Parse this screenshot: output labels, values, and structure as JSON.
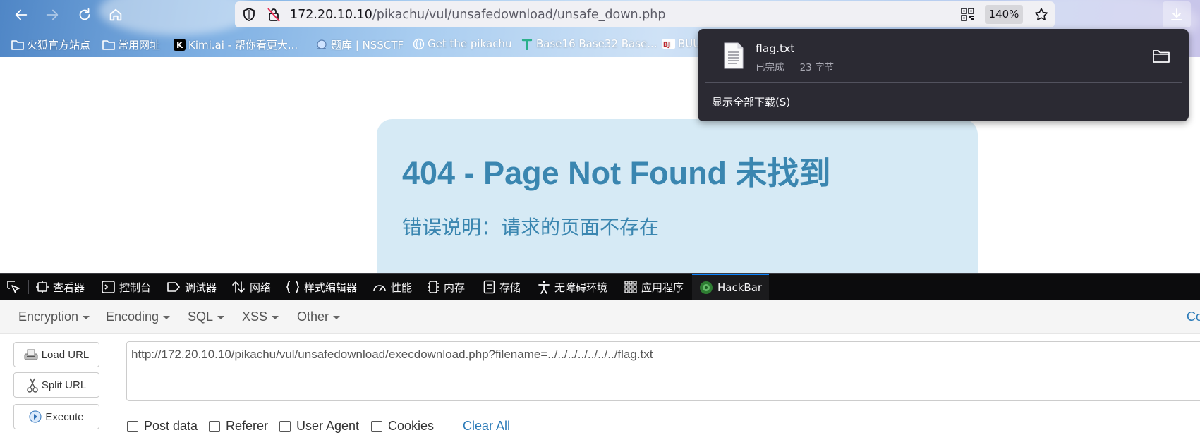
{
  "browser": {
    "url_host": "172.20.10.10",
    "url_path": "/pikachu/vul/unsafedownload/unsafe_down.php",
    "zoom": "140%"
  },
  "bookmarks": [
    {
      "label": "火狐官方站点",
      "icon": "folder-icon"
    },
    {
      "label": "常用网址",
      "icon": "folder-icon"
    },
    {
      "label": "Kimi.ai - 帮你看更大...",
      "icon": "kimi-icon"
    },
    {
      "label": "题库 | NSSCTF",
      "icon": "nssctf-icon"
    },
    {
      "label": "Get the pikachu",
      "icon": "globe-icon"
    },
    {
      "label": "Base16 Base32 Base...",
      "icon": "t-icon"
    },
    {
      "label": "BUU",
      "icon": "buu-icon"
    }
  ],
  "page": {
    "title": "404 - Page Not Found 未找到",
    "description": "错误说明：请求的页面不存在"
  },
  "download_panel": {
    "file_name": "flag.txt",
    "status": "已完成 — 23 字节",
    "show_all": "显示全部下载(S)"
  },
  "devtools": {
    "tabs": [
      {
        "label": "查看器",
        "icon": "inspector-icon"
      },
      {
        "label": "控制台",
        "icon": "console-icon"
      },
      {
        "label": "调试器",
        "icon": "debugger-icon"
      },
      {
        "label": "网络",
        "icon": "network-icon"
      },
      {
        "label": "样式编辑器",
        "icon": "style-editor-icon"
      },
      {
        "label": "性能",
        "icon": "performance-icon"
      },
      {
        "label": "内存",
        "icon": "memory-icon"
      },
      {
        "label": "存储",
        "icon": "storage-icon"
      },
      {
        "label": "无障碍环境",
        "icon": "accessibility-icon"
      },
      {
        "label": "应用程序",
        "icon": "application-icon"
      },
      {
        "label": "HackBar",
        "icon": "hackbar-icon"
      }
    ],
    "active_tab": "HackBar"
  },
  "hackbar": {
    "menus": [
      "Encryption",
      "Encoding",
      "SQL",
      "XSS",
      "Other"
    ],
    "menu_right": "Co",
    "buttons": {
      "load_url": "Load URL",
      "split_url": "Split URL",
      "execute": "Execute"
    },
    "url_value": "http://172.20.10.10/pikachu/vul/unsafedownload/execdownload.php?filename=../../../../../../../flag.txt",
    "checkboxes": {
      "post_data": "Post data",
      "referer": "Referer",
      "user_agent": "User Agent",
      "cookies": "Cookies"
    },
    "clear_all": "Clear All"
  },
  "colors": {
    "accent": "#3a86b0",
    "hackbar_link": "#2a7ab8",
    "panel_bg": "#2b2a33",
    "devtools_bg": "#0c0c0d"
  }
}
